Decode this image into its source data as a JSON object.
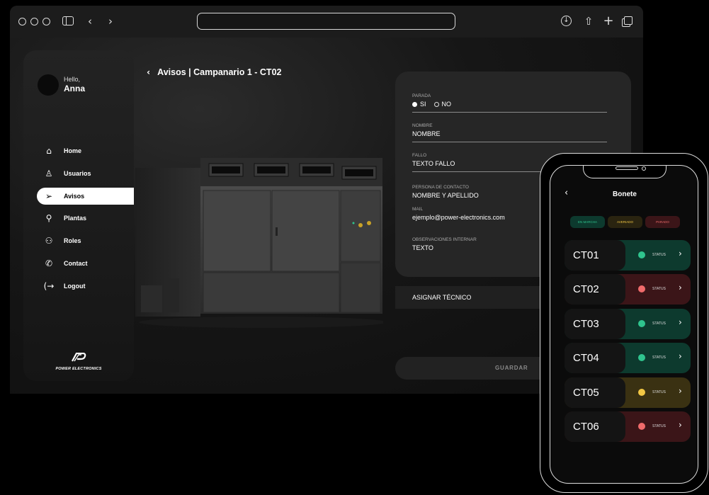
{
  "colors": {
    "background": "#000000",
    "panel": "#262626",
    "status_green": "#2fc48e",
    "status_red": "#ef6b6b",
    "status_yellow": "#f2c744",
    "row_green_bg": "#0d3a2e",
    "row_red_bg": "#3b1518",
    "row_yellow_bg": "#3a3112"
  },
  "user": {
    "greeting": "Hello,",
    "name": "Anna"
  },
  "sidebar": {
    "items": [
      {
        "label": "Home",
        "icon": "home-icon",
        "glyph": "⬡"
      },
      {
        "label": "Usuarios",
        "icon": "user-icon",
        "glyph": "⚲"
      },
      {
        "label": "Avisos",
        "icon": "send-icon",
        "glyph": "➢"
      },
      {
        "label": "Plantas",
        "icon": "location-pin-icon",
        "glyph": "⚲"
      },
      {
        "label": "Roles",
        "icon": "users-icon",
        "glyph": "⚇"
      },
      {
        "label": "Contact",
        "icon": "phone-icon",
        "glyph": "✆"
      },
      {
        "label": "Logout",
        "icon": "logout-icon",
        "glyph": "(→"
      }
    ],
    "active_index": 2,
    "brand": "POWER ELECTRONICS"
  },
  "page": {
    "title": "Avisos | Campanario 1 - CT02"
  },
  "form": {
    "parada": {
      "label": "PARADA",
      "options": [
        "SI",
        "NO"
      ],
      "selected": "SI"
    },
    "nombre": {
      "label": "NOMBRE",
      "value": "NOMBRE"
    },
    "fallo": {
      "label": "FALLO",
      "value": "TEXTO FALLO"
    },
    "contacto": {
      "label": "PERSONA DE CONTACTO",
      "value": "NOMBRE Y APELLIDO"
    },
    "mail": {
      "label": "MAIL",
      "value": "ejemplo@power-electronics.com"
    },
    "observaciones": {
      "label": "OBSERVACIONES INTERNAR",
      "value": "TEXTO"
    },
    "assign_label": "ASIGNAR TÉCNICO",
    "save_label": "GUARDAR"
  },
  "phone": {
    "title": "Bonete",
    "filters": [
      {
        "label": "EN MARCHA",
        "status": "green"
      },
      {
        "label": "AVERIADO",
        "status": "yellow"
      },
      {
        "label": "PARADO",
        "status": "red"
      }
    ],
    "rows": [
      {
        "name": "CT01",
        "status": "green",
        "status_label": "STATUS"
      },
      {
        "name": "CT02",
        "status": "red",
        "status_label": "STATUS"
      },
      {
        "name": "CT03",
        "status": "green",
        "status_label": "STATUS"
      },
      {
        "name": "CT04",
        "status": "green",
        "status_label": "STATUS"
      },
      {
        "name": "CT05",
        "status": "yellow",
        "status_label": "STATUS"
      },
      {
        "name": "CT06",
        "status": "red",
        "status_label": "STATUS"
      }
    ]
  }
}
